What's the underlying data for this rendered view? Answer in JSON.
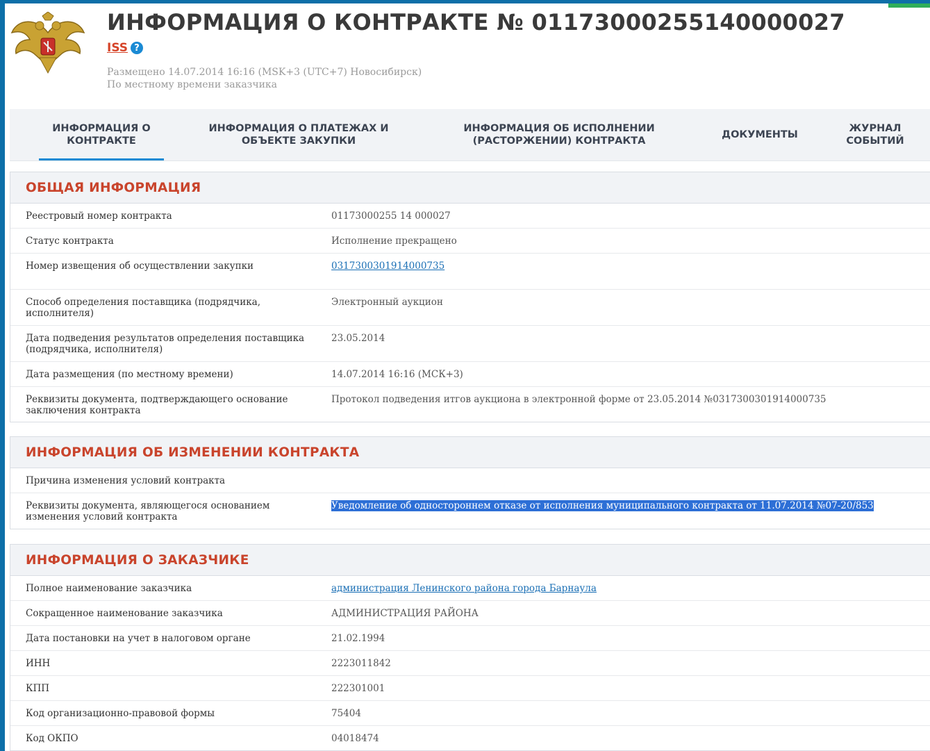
{
  "header": {
    "title": "ИНФОРМАЦИЯ О КОНТРАКТЕ № 01173000255140000027",
    "iss_link": "ISS",
    "posted_line1": "Размещено 14.07.2014 16:16 (MSK+3 (UTC+7) Новосибирск)",
    "posted_line2": "По местному времени заказчика"
  },
  "tabs": [
    {
      "label": "ИНФОРМАЦИЯ О КОНТРАКТЕ",
      "active": true
    },
    {
      "label": "ИНФОРМАЦИЯ О ПЛАТЕЖАХ И ОБЪЕКТЕ ЗАКУПКИ"
    },
    {
      "label": "ИНФОРМАЦИЯ ОБ ИСПОЛНЕНИИ (РАСТОРЖЕНИИ) КОНТРАКТА"
    },
    {
      "label": "ДОКУМЕНТЫ"
    },
    {
      "label": "ЖУРНАЛ СОБЫТИЙ"
    }
  ],
  "general": {
    "title": "ОБЩАЯ ИНФОРМАЦИЯ",
    "rows": [
      {
        "label": "Реестровый номер контракта",
        "value": "01173000255 14 000027"
      },
      {
        "label": "Статус контракта",
        "value": "Исполнение прекращено"
      },
      {
        "label": "Номер извещения об осуществлении закупки",
        "value": "0317300301914000735"
      },
      {
        "label": "Способ определения поставщика (подрядчика, исполнителя)",
        "value": "Электронный аукцион"
      },
      {
        "label": "Дата подведения результатов определения поставщика (подрядчика, исполнителя)",
        "value": "23.05.2014"
      },
      {
        "label": "Дата размещения (по местному времени)",
        "value": "14.07.2014 16:16 (МСК+3)"
      },
      {
        "label": "Реквизиты документа, подтверждающего основание заключения контракта",
        "value": "Протокол подведения итгов аукциона в электронной форме от 23.05.2014 №0317300301914000735"
      }
    ]
  },
  "changes": {
    "title": "ИНФОРМАЦИЯ ОБ ИЗМЕНЕНИИ КОНТРАКТА",
    "rows": [
      {
        "label": "Причина изменения условий контракта",
        "value": ""
      },
      {
        "label": "Реквизиты документа, являющегося основанием изменения условий контракта",
        "value": "Уведомление об одностороннем отказе от исполнения муниципального контракта от 11.07.2014 №07-20/853"
      }
    ]
  },
  "customer": {
    "title": "ИНФОРМАЦИЯ О ЗАКАЗЧИКЕ",
    "rows": [
      {
        "label": "Полное наименование заказчика",
        "value": "администрация Ленинского района города Барнаула"
      },
      {
        "label": "Сокращенное наименование заказчика",
        "value": "АДМИНИСТРАЦИЯ РАЙОНА"
      },
      {
        "label": "Дата постановки на учет в налоговом органе",
        "value": "21.02.1994"
      },
      {
        "label": "ИНН",
        "value": "2223011842"
      },
      {
        "label": "КПП",
        "value": "222301001"
      },
      {
        "label": "Код организационно-правовой формы",
        "value": "75404"
      },
      {
        "label": "Код ОКПО",
        "value": "04018474"
      }
    ]
  }
}
